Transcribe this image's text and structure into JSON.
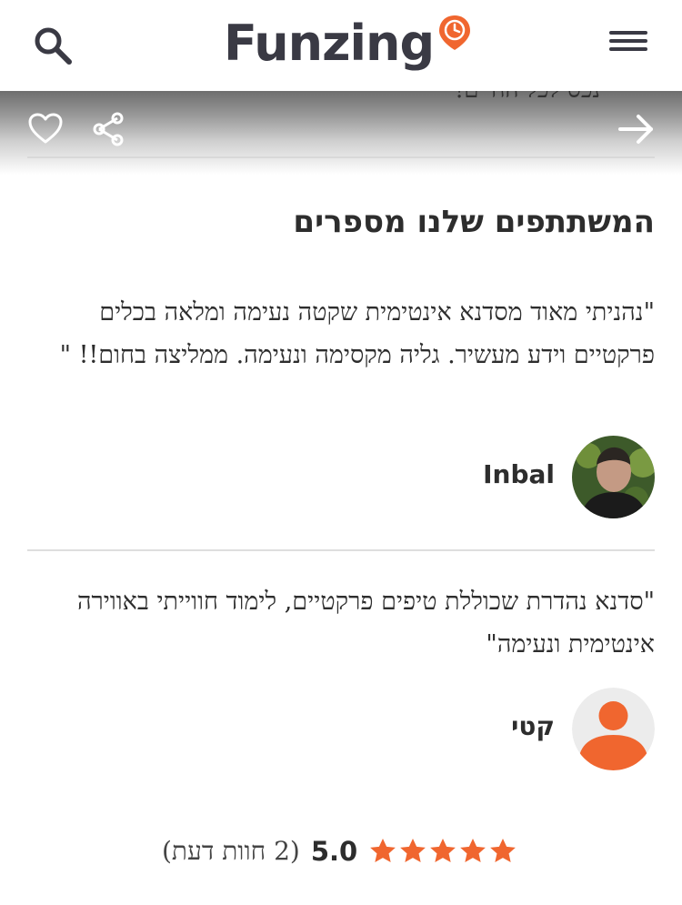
{
  "header": {
    "logo_text": "Funzing",
    "icons": {
      "search": "search-icon",
      "menu": "hamburger-menu-icon",
      "logo_pin": "clock-pin-icon"
    },
    "brand_color": "#f0662f"
  },
  "action_bar": {
    "behind_text": "נכס לכל החיים!",
    "icons": {
      "favorite": "heart-icon",
      "share": "share-icon",
      "forward": "arrow-right-icon"
    }
  },
  "reviews_section": {
    "title": "המשתתפים שלנו מספרים",
    "reviews": [
      {
        "text": "\"נהניתי מאוד מסדנא אינטימית שקטה נעימה ומלאה בכלים פרקטיים וידע מעשיר. גליה מקסימה ונעימה. ממליצה בחום!! \"",
        "reviewer_name": "Inbal",
        "avatar": "user-photo"
      },
      {
        "text": "\"סדנא נהדרת שכוללת טיפים פרקטיים, לימוד חווייתי באווירה אינטימית ונעימה\"",
        "reviewer_name": "קטי",
        "avatar": "default-user-icon"
      }
    ]
  },
  "rating": {
    "value": "5.0",
    "count_text": "(2 חוות דעת)",
    "stars": 5,
    "star_color": "#f0662f"
  }
}
